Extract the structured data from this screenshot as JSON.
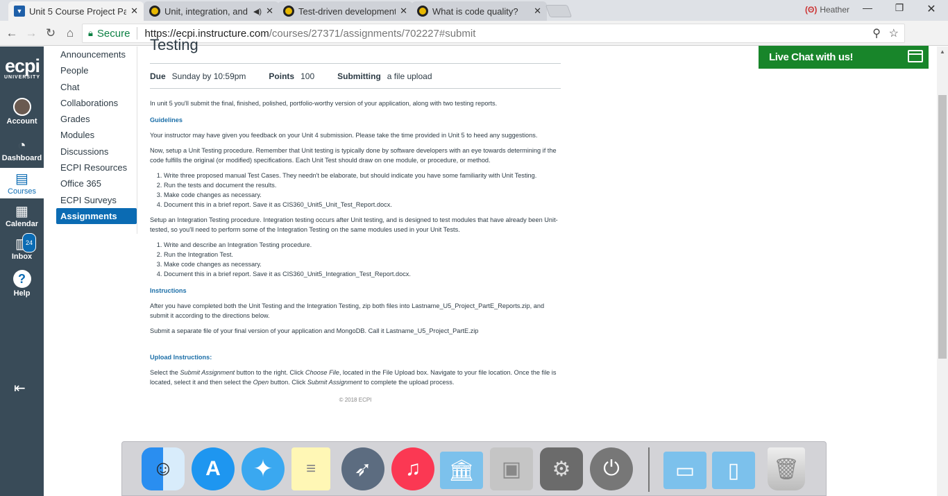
{
  "browser": {
    "tabs": [
      {
        "title": "Unit 5 Course Project Par",
        "favicon": "canvas-icon"
      },
      {
        "title": "Unit, integration, and",
        "favicon": "youtube-icon"
      },
      {
        "title": "Test-driven development",
        "favicon": "youtube-icon"
      },
      {
        "title": "What is code quality?",
        "favicon": "youtube-icon"
      }
    ],
    "profile_name": "Heather",
    "secure_label": "Secure",
    "url_host": "https://ecpi.instructure.com",
    "url_path": "/courses/27371/assignments/702227#submit"
  },
  "global_nav": {
    "logo_text": "ecpi",
    "logo_sub": "UNIVERSITY",
    "items": [
      {
        "label": "Account"
      },
      {
        "label": "Dashboard"
      },
      {
        "label": "Courses"
      },
      {
        "label": "Calendar"
      },
      {
        "label": "Inbox",
        "badge": "24"
      },
      {
        "label": "Help"
      }
    ]
  },
  "course_nav": {
    "items": [
      "Announcements",
      "People",
      "Chat",
      "Collaborations",
      "Grades",
      "Modules",
      "Discussions",
      "ECPI Resources",
      "Office 365",
      "ECPI Surveys",
      "Assignments"
    ]
  },
  "assignment": {
    "title_partial": "Testing",
    "due_label": "Due",
    "due_value": "Sunday by 10:59pm",
    "points_label": "Points",
    "points_value": "100",
    "submitting_label": "Submitting",
    "submitting_value": "a file upload",
    "intro": "In unit 5 you'll submit the final, finished, polished, portfolio-worthy version of your application, along with two testing reports.",
    "guidelines_heading": "Guidelines",
    "guidelines_p1": "Your instructor may have given you feedback on your Unit 4 submission. Please take the time provided in Unit 5 to heed any suggestions.",
    "guidelines_p2": "Now, setup a Unit Testing procedure. Remember that Unit testing is typically done by software developers with an eye towards determining if the code fulfills the original (or modified) specifications. Each Unit Test should draw on one module, or procedure, or method.",
    "unit_steps": [
      "Write three proposed manual Test Cases. They needn't be elaborate, but should indicate you have some familiarity with Unit Testing.",
      "Run the tests and document the results.",
      "Make code changes as necessary.",
      "Document this in a brief report. Save it as CIS360_Unit5_Unit_Test_Report.docx."
    ],
    "integration_p": "Setup an Integration Testing procedure. Integration testing occurs after Unit testing, and is designed to test modules that have already been Unit-tested, so you'll need to perform some of the Integration Testing on the same modules used in your Unit Tests.",
    "integration_steps": [
      "Write and describe an Integration Testing procedure.",
      "Run the Integration Test.",
      "Make code changes as necessary.",
      "Document this in a brief report. Save it as CIS360_Unit5_Integration_Test_Report.docx."
    ],
    "instructions_heading": "Instructions",
    "instructions_p1": "After you have completed both the Unit Testing and the Integration Testing, zip both files into Lastname_U5_Project_PartE_Reports.zip, and submit it according to the directions below.",
    "instructions_p2": "Submit a separate file of your final version of your application and MongoDB. Call it Lastname_U5_Project_PartE.zip",
    "upload_heading": "Upload Instructions:",
    "upload_a": "Select the ",
    "upload_b": "Submit Assignment",
    "upload_c": " button to the right. Click ",
    "upload_d": "Choose File",
    "upload_e": ", located in the File Upload box. Navigate to your file location. Once the file is located, select it and then select the ",
    "upload_f": "Open",
    "upload_g": " button. Click ",
    "upload_h": "Submit Assignment",
    "upload_i": " to complete the upload process.",
    "footer": "© 2018 ECPI"
  },
  "live_chat": {
    "label": "Live Chat with us!"
  },
  "dock": {
    "apps": [
      "finder-icon",
      "app-store-icon",
      "safari-icon",
      "notes-icon",
      "launchpad-icon",
      "itunes-icon",
      "applications-folder-icon",
      "mac-icon",
      "system-preferences-icon",
      "power-icon",
      "documents-folder-icon",
      "downloads-folder-icon",
      "trash-icon"
    ]
  },
  "colors": {
    "canvas_nav": "#394b58",
    "link_blue": "#0b6bb3",
    "live_chat_green": "#18852a"
  }
}
